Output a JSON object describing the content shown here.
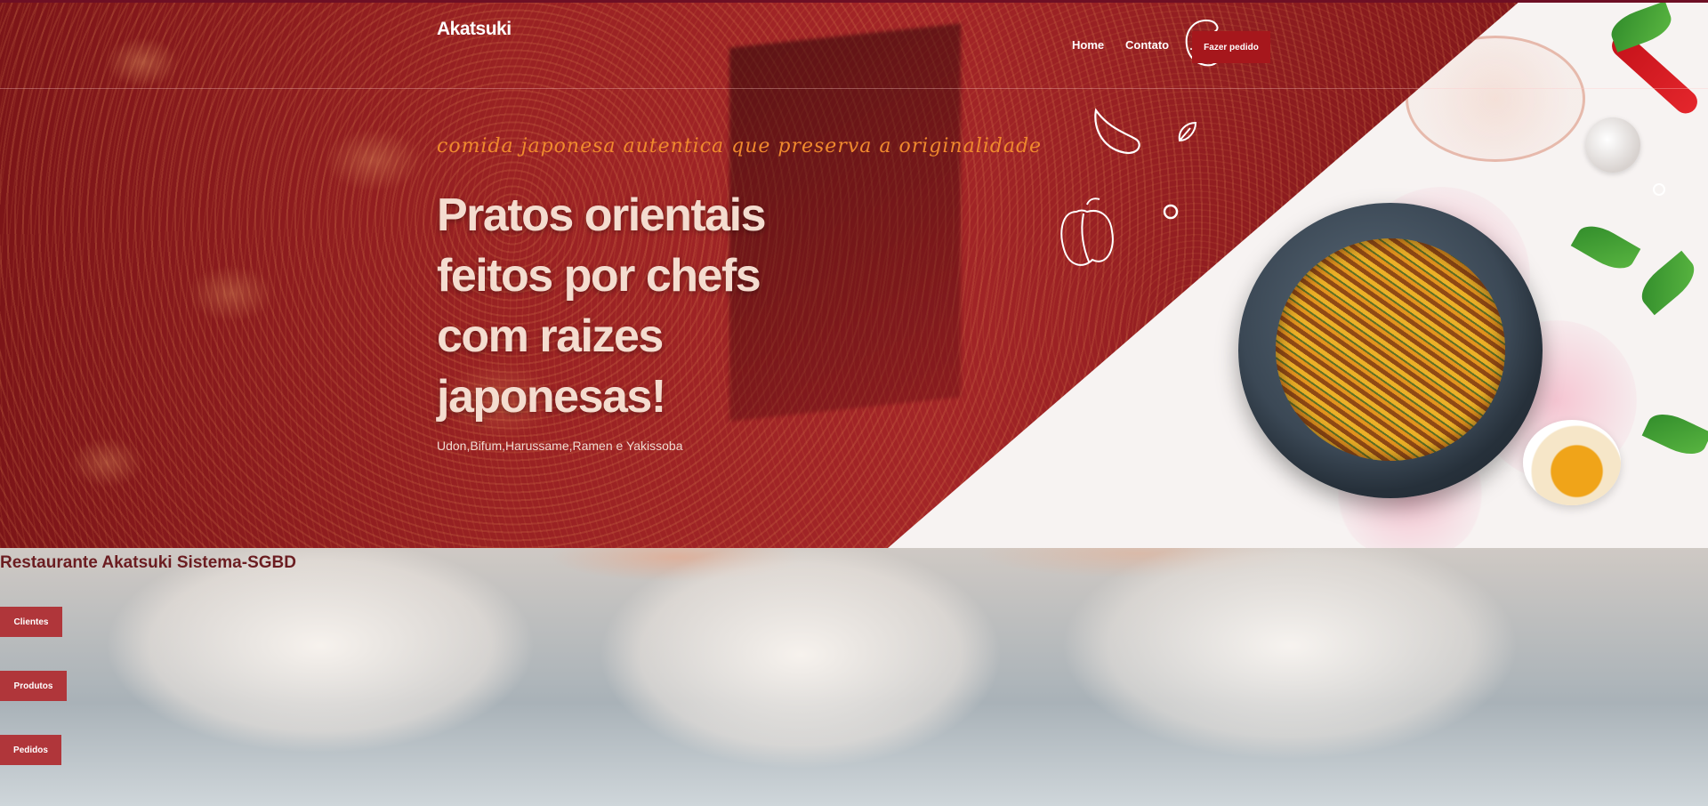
{
  "nav": {
    "brand": "Akatsuki",
    "links": [
      "Home",
      "Contato"
    ],
    "order_button": "Fazer pedido"
  },
  "hero": {
    "tagline": "comida japonesa autentica que preserva a originalidade",
    "headline": "Pratos orientais feitos por chefs com raizes japonesas!",
    "subtitle": "Udon,Bifum,Harussame,Ramen e Yakissoba"
  },
  "system": {
    "title": "Restaurante Akatsuki Sistema-SGBD",
    "buttons": [
      "Clientes",
      "Produtos",
      "Pedidos"
    ]
  },
  "colors": {
    "hero_red": "#8e1d1f",
    "button_red": "#a6171c",
    "side_button_red": "#b0363a",
    "tagline_orange": "#f08a2e",
    "headline_cream": "#f4dccf"
  },
  "icons": [
    "shrimp-icon",
    "garlic-doodle-icon",
    "pepper-doodle-icon",
    "circle-doodle-icon",
    "leaf-doodle-icon"
  ]
}
